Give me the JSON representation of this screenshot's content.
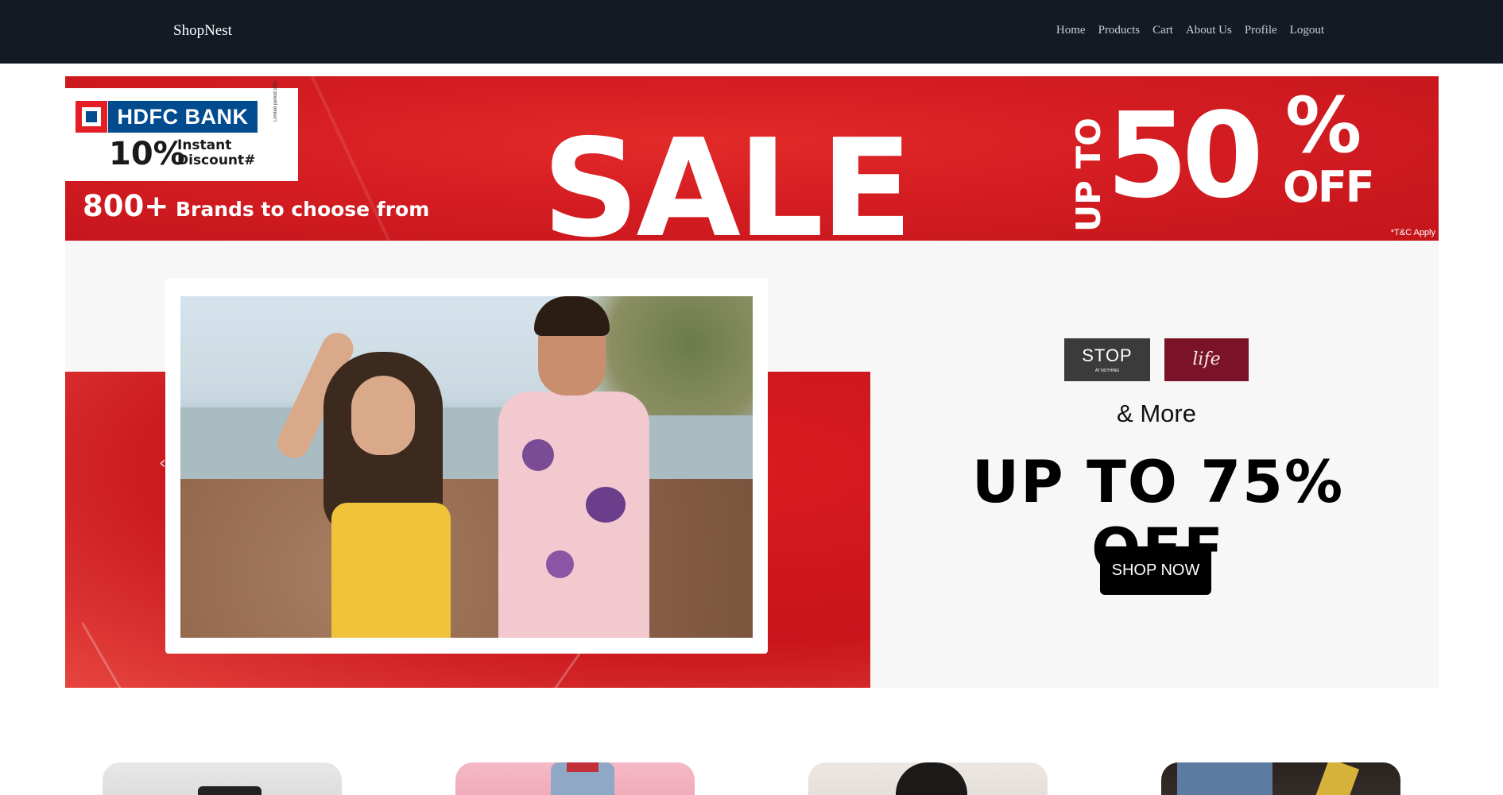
{
  "navbar": {
    "brand": "ShopNest",
    "links": [
      "Home",
      "Products",
      "Cart",
      "About Us",
      "Profile",
      "Logout"
    ],
    "background": "#131a24"
  },
  "sale_banner": {
    "bank_name": "HDFC BANK",
    "discount": "10%",
    "instant_line1": "Instant",
    "instant_line2": "Discount#",
    "fine_print": "Limited period offer",
    "brands_count": "800+",
    "brands_text": "Brands to choose from",
    "sale": "SALE",
    "up_to": "UP TO",
    "fifty": "50",
    "percent": "%",
    "off": "OFF",
    "tnc": "*T&C Apply",
    "background": "#d41d22"
  },
  "carousel": {
    "stop_logo": "STOP",
    "stop_tagline": "AT NOTHING",
    "life_logo": "life",
    "and_more": "& More",
    "headline": "UP TO 75% OFF",
    "cta": "SHOP NOW",
    "prev_arrow": "‹",
    "next_arrow": "›",
    "photo_alt": "Couple in summer outfits at the beach",
    "accent": "#c8141a"
  },
  "category_cards": [
    {
      "icon": "product-image"
    },
    {
      "icon": "product-image"
    },
    {
      "icon": "product-image"
    },
    {
      "icon": "product-image"
    }
  ]
}
